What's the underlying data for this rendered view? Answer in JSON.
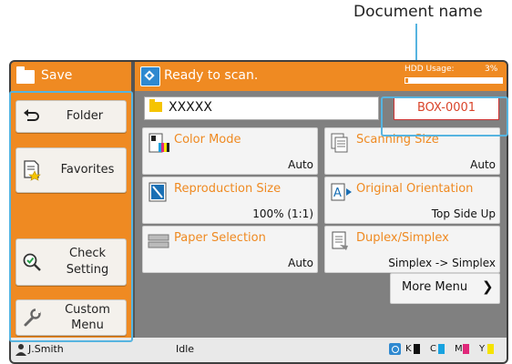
{
  "annotation": {
    "document_name_label": "Document name"
  },
  "left_panel": {
    "title": "Save",
    "buttons": [
      {
        "label": "Folder",
        "icon": "back-arrow-icon"
      },
      {
        "label": "Favorites",
        "icon": "favorites-doc-icon"
      },
      {
        "label_line1": "Check",
        "label_line2": "Setting",
        "icon": "magnifier-check-icon"
      },
      {
        "label_line1": "Custom",
        "label_line2": "Menu",
        "icon": "wrench-icon"
      }
    ]
  },
  "header": {
    "status": "Ready to scan.",
    "hdd_label": "HDD Usage:",
    "hdd_value": "3%",
    "hdd_fraction": 0.03
  },
  "document": {
    "name": "XXXXX",
    "box": "BOX-0001"
  },
  "tiles": [
    {
      "title": "Color Mode",
      "value": "Auto",
      "icon": "color-mode-icon"
    },
    {
      "title": "Scanning Size",
      "value": "Auto",
      "icon": "scanning-size-icon"
    },
    {
      "title": "Reproduction Size",
      "value": "100% (1:1)",
      "icon": "reproduction-size-icon"
    },
    {
      "title": "Original Orientation",
      "value": "Top Side Up",
      "icon": "orientation-icon"
    },
    {
      "title": "Paper Selection",
      "value": "Auto",
      "icon": "paper-tray-icon"
    },
    {
      "title": "Duplex/Simplex",
      "value": "Simplex -> Simplex",
      "icon": "duplex-icon"
    }
  ],
  "more_menu": {
    "label": "More Menu"
  },
  "status_bar": {
    "user": "J.Smith",
    "state": "Idle",
    "inks": [
      {
        "label": "K",
        "color": "#111111"
      },
      {
        "label": "C",
        "color": "#19a3e0"
      },
      {
        "label": "M",
        "color": "#e0287a"
      },
      {
        "label": "Y",
        "color": "#f5e300"
      }
    ]
  },
  "colors": {
    "accent_orange": "#ef8a22",
    "highlight_blue": "#56b4e0",
    "title_red": "#d9442a"
  }
}
